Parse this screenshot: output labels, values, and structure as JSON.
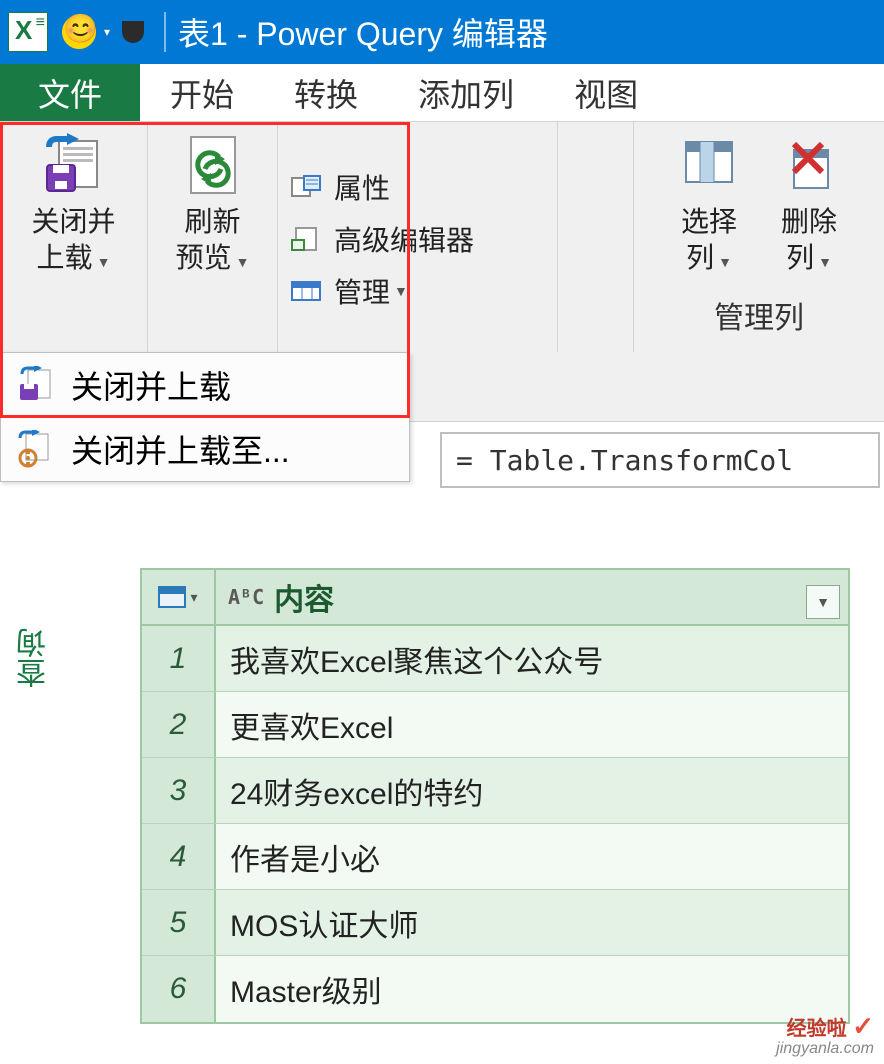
{
  "title": "表1 - Power Query 编辑器",
  "menubar": {
    "file": "文件",
    "home": "开始",
    "transform": "转换",
    "addcol": "添加列",
    "view": "视图"
  },
  "ribbon": {
    "close_load_line1": "关闭并",
    "close_load_line2": "上载",
    "refresh_line1": "刷新",
    "refresh_line2": "预览",
    "properties": "属性",
    "advanced_editor": "高级编辑器",
    "manage": "管理",
    "select_cols_line1": "选择",
    "select_cols_line2": "列",
    "remove_cols_line1": "删除",
    "remove_cols_line2": "列",
    "manage_cols_group": "管理列"
  },
  "dropdown": {
    "close_load": "关闭并上载",
    "close_load_to": "关闭并上载至..."
  },
  "side_tab": "查询",
  "formula": "= Table.TransformCol",
  "table": {
    "column_header": "内容",
    "type_prefix": "AᴮC",
    "rows": [
      {
        "n": "1",
        "v": "我喜欢Excel聚焦这个公众号"
      },
      {
        "n": "2",
        "v": "更喜欢Excel"
      },
      {
        "n": "3",
        "v": "24财务excel的特约"
      },
      {
        "n": "4",
        "v": "作者是小必"
      },
      {
        "n": "5",
        "v": "MOS认证大师"
      },
      {
        "n": "6",
        "v": "Master级别"
      }
    ]
  },
  "watermark": {
    "line1": "经验啦",
    "line2": "jingyanla.com"
  }
}
